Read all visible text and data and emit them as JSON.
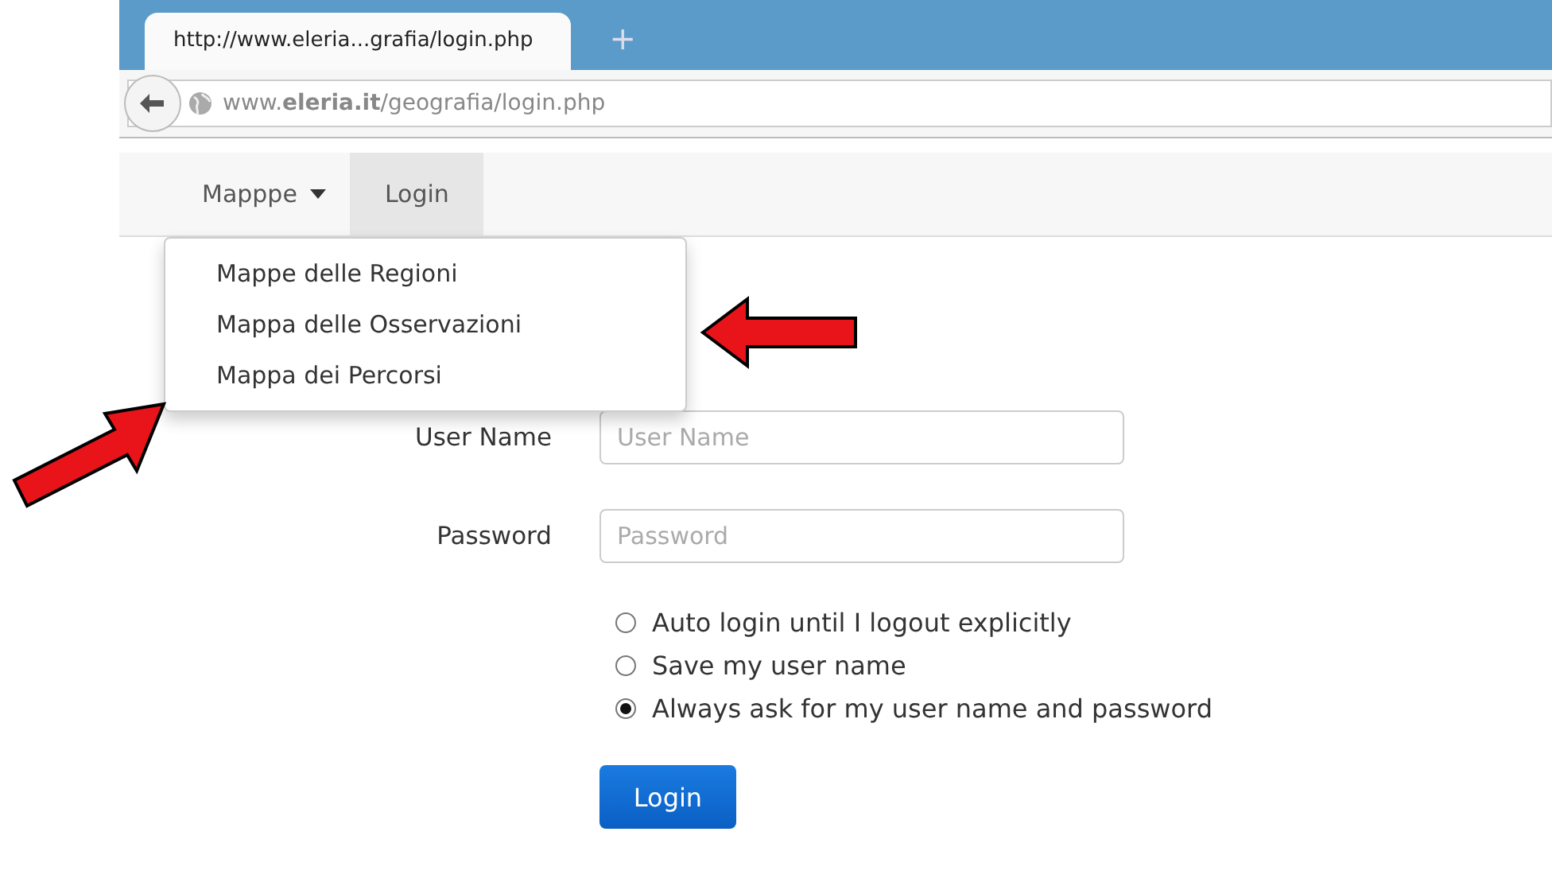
{
  "browser": {
    "tab_title": "http://www.eleria...grafia/login.php",
    "new_tab": "+",
    "address": "www.**eleria.it**/geografia/login.php"
  },
  "navbar": {
    "items": [
      {
        "label": "Mapppe",
        "kind": "dropdown",
        "selected": false
      },
      {
        "label": "Login",
        "kind": "link",
        "selected": true
      }
    ]
  },
  "dropdown": {
    "items": [
      "Mappe delle Regioni",
      "Mappa delle Osservazioni",
      "Mappa dei Percorsi"
    ]
  },
  "form": {
    "fields": [
      {
        "label": "User Name",
        "placeholder": "User Name"
      },
      {
        "label": "Password",
        "placeholder": "Password"
      }
    ],
    "options": [
      {
        "label": "Auto login until I logout explicitly",
        "selected": false
      },
      {
        "label": "Save my user name",
        "selected": false
      },
      {
        "label": "Always ask for my user name and password",
        "selected": true
      }
    ],
    "submit": "Login"
  },
  "annotations": [
    {
      "kind": "arrow-left"
    },
    {
      "kind": "arrow-up-right"
    }
  ]
}
